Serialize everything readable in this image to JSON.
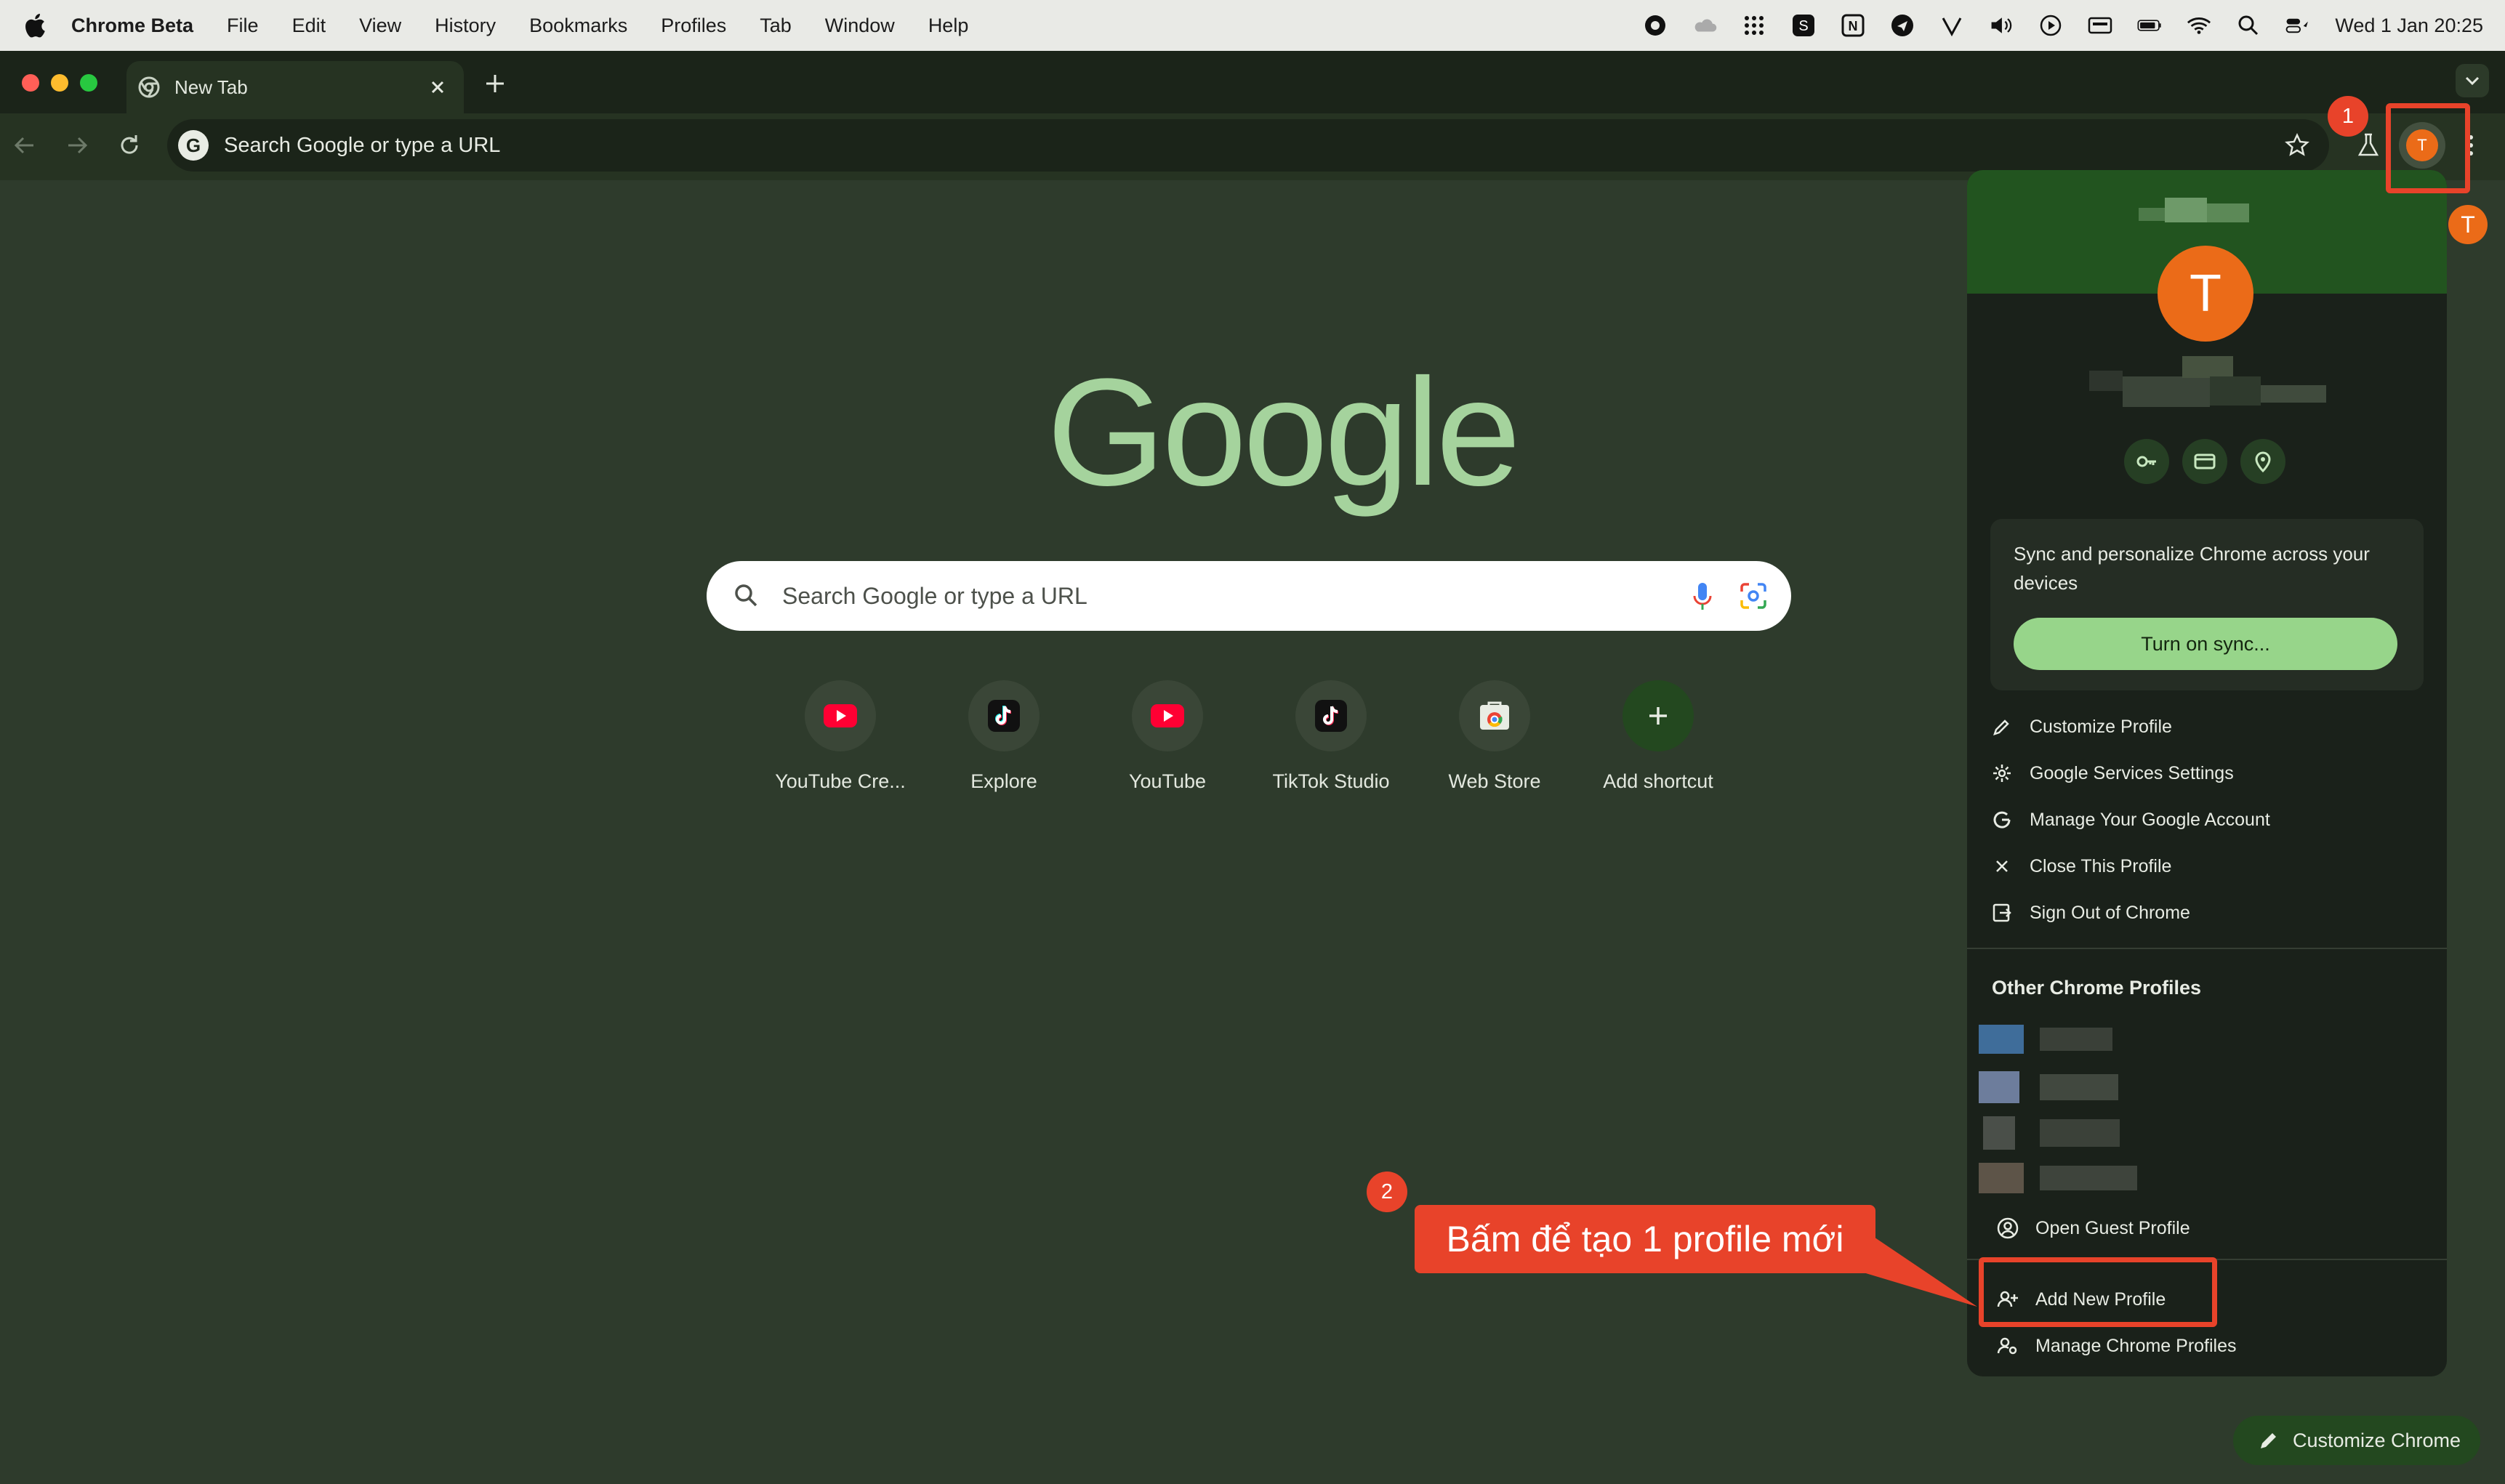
{
  "menubar": {
    "app": "Chrome Beta",
    "items": [
      "File",
      "Edit",
      "View",
      "History",
      "Bookmarks",
      "Profiles",
      "Tab",
      "Window",
      "Help"
    ],
    "clock": "Wed 1 Jan  20:25"
  },
  "tab": {
    "title": "New Tab"
  },
  "omnibox": {
    "placeholder": "Search Google or type a URL"
  },
  "ntp": {
    "logo": "Google",
    "search_placeholder": "Search Google or type a URL",
    "shortcuts": [
      {
        "label": "YouTube Cre...",
        "icon": "youtube-icon"
      },
      {
        "label": "Explore",
        "icon": "tiktok-icon"
      },
      {
        "label": "YouTube",
        "icon": "youtube-icon"
      },
      {
        "label": "TikTok Studio",
        "icon": "tiktok-icon"
      },
      {
        "label": "Web Store",
        "icon": "webstore-icon"
      },
      {
        "label": "Add shortcut",
        "icon": "plus-icon"
      }
    ],
    "customize_label": "Customize Chrome"
  },
  "profile_menu": {
    "avatar_letter": "T",
    "sync_text": "Sync and personalize Chrome across your devices",
    "sync_button": "Turn on sync...",
    "items": [
      {
        "label": "Customize Profile",
        "icon": "pencil-icon"
      },
      {
        "label": "Google Services Settings",
        "icon": "gear-icon"
      },
      {
        "label": "Manage Your Google Account",
        "icon": "google-g-icon"
      },
      {
        "label": "Close This Profile",
        "icon": "close-icon"
      },
      {
        "label": "Sign Out of Chrome",
        "icon": "sign-out-icon"
      }
    ],
    "other_title": "Other Chrome Profiles",
    "guest_label": "Open Guest Profile",
    "add_label": "Add New Profile",
    "manage_label": "Manage Chrome Profiles"
  },
  "annotations": {
    "badge1": "1",
    "badge2": "2",
    "callout": "Bấm để tạo 1 profile mới",
    "color": "#e8432a"
  },
  "toolbar": {
    "avatar_letter": "T"
  }
}
